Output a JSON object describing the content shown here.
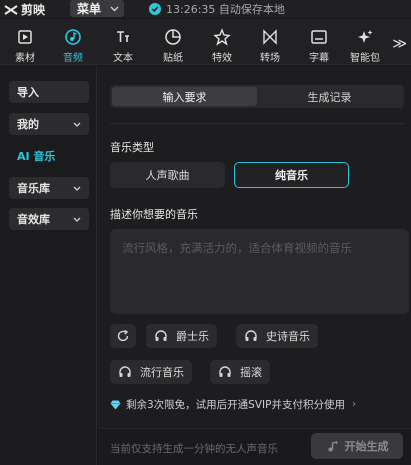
{
  "app": {
    "name": "剪映"
  },
  "titlebar": {
    "menu_label": "菜单",
    "status_text": "13:26:35 自动保存本地",
    "colors": {
      "accent": "#2ec6d8"
    }
  },
  "toolbar": {
    "tabs": [
      {
        "label": "素材",
        "icon": "media-icon"
      },
      {
        "label": "音频",
        "icon": "audio-icon",
        "active": true
      },
      {
        "label": "文本",
        "icon": "text-icon"
      },
      {
        "label": "贴纸",
        "icon": "sticker-icon"
      },
      {
        "label": "特效",
        "icon": "effects-icon"
      },
      {
        "label": "转场",
        "icon": "transition-icon"
      },
      {
        "label": "字幕",
        "icon": "caption-icon"
      },
      {
        "label": "智能包",
        "icon": "smart-icon"
      }
    ],
    "more": "≫"
  },
  "sidebar": {
    "items": [
      {
        "label": "导入"
      },
      {
        "label": "我的",
        "caret": true
      },
      {
        "label": "AI 音乐",
        "selected": true
      },
      {
        "label": "音乐库",
        "caret": true
      },
      {
        "label": "音效库",
        "caret": true
      }
    ]
  },
  "main": {
    "tabs": [
      {
        "label": "输入要求",
        "active": true
      },
      {
        "label": "生成记录"
      }
    ],
    "music_type_label": "音乐类型",
    "music_types": [
      {
        "label": "人声歌曲"
      },
      {
        "label": "纯音乐",
        "active": true
      }
    ],
    "describe_label": "描述你想要的音乐",
    "prompt_placeholder": "流行风格，充满活力的，适合体育视频的音乐",
    "chips": [
      {
        "label": "爵士乐"
      },
      {
        "label": "史诗音乐"
      },
      {
        "label": "流行音乐"
      },
      {
        "label": "摇滚"
      }
    ],
    "quota_text": "剩余3次限免，试用后开通SVIP并支付积分使用",
    "footer_text": "当前仅支持生成一分钟的无人声音乐",
    "generate_label": "开始生成"
  }
}
